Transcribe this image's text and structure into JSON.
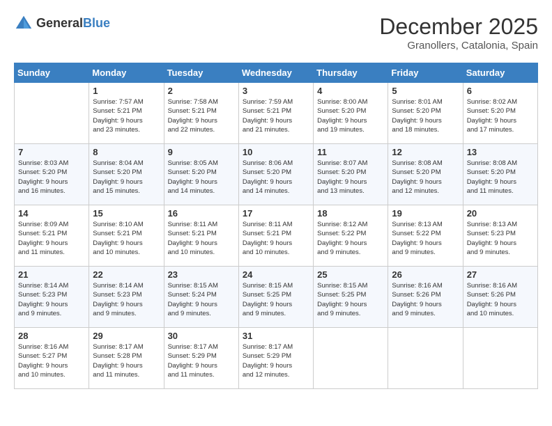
{
  "logo": {
    "general": "General",
    "blue": "Blue"
  },
  "header": {
    "month": "December 2025",
    "location": "Granollers, Catalonia, Spain"
  },
  "days_of_week": [
    "Sunday",
    "Monday",
    "Tuesday",
    "Wednesday",
    "Thursday",
    "Friday",
    "Saturday"
  ],
  "weeks": [
    [
      {
        "day": "",
        "info": ""
      },
      {
        "day": "1",
        "info": "Sunrise: 7:57 AM\nSunset: 5:21 PM\nDaylight: 9 hours\nand 23 minutes."
      },
      {
        "day": "2",
        "info": "Sunrise: 7:58 AM\nSunset: 5:21 PM\nDaylight: 9 hours\nand 22 minutes."
      },
      {
        "day": "3",
        "info": "Sunrise: 7:59 AM\nSunset: 5:21 PM\nDaylight: 9 hours\nand 21 minutes."
      },
      {
        "day": "4",
        "info": "Sunrise: 8:00 AM\nSunset: 5:20 PM\nDaylight: 9 hours\nand 19 minutes."
      },
      {
        "day": "5",
        "info": "Sunrise: 8:01 AM\nSunset: 5:20 PM\nDaylight: 9 hours\nand 18 minutes."
      },
      {
        "day": "6",
        "info": "Sunrise: 8:02 AM\nSunset: 5:20 PM\nDaylight: 9 hours\nand 17 minutes."
      }
    ],
    [
      {
        "day": "7",
        "info": "Sunrise: 8:03 AM\nSunset: 5:20 PM\nDaylight: 9 hours\nand 16 minutes."
      },
      {
        "day": "8",
        "info": "Sunrise: 8:04 AM\nSunset: 5:20 PM\nDaylight: 9 hours\nand 15 minutes."
      },
      {
        "day": "9",
        "info": "Sunrise: 8:05 AM\nSunset: 5:20 PM\nDaylight: 9 hours\nand 14 minutes."
      },
      {
        "day": "10",
        "info": "Sunrise: 8:06 AM\nSunset: 5:20 PM\nDaylight: 9 hours\nand 14 minutes."
      },
      {
        "day": "11",
        "info": "Sunrise: 8:07 AM\nSunset: 5:20 PM\nDaylight: 9 hours\nand 13 minutes."
      },
      {
        "day": "12",
        "info": "Sunrise: 8:08 AM\nSunset: 5:20 PM\nDaylight: 9 hours\nand 12 minutes."
      },
      {
        "day": "13",
        "info": "Sunrise: 8:08 AM\nSunset: 5:20 PM\nDaylight: 9 hours\nand 11 minutes."
      }
    ],
    [
      {
        "day": "14",
        "info": "Sunrise: 8:09 AM\nSunset: 5:21 PM\nDaylight: 9 hours\nand 11 minutes."
      },
      {
        "day": "15",
        "info": "Sunrise: 8:10 AM\nSunset: 5:21 PM\nDaylight: 9 hours\nand 10 minutes."
      },
      {
        "day": "16",
        "info": "Sunrise: 8:11 AM\nSunset: 5:21 PM\nDaylight: 9 hours\nand 10 minutes."
      },
      {
        "day": "17",
        "info": "Sunrise: 8:11 AM\nSunset: 5:21 PM\nDaylight: 9 hours\nand 10 minutes."
      },
      {
        "day": "18",
        "info": "Sunrise: 8:12 AM\nSunset: 5:22 PM\nDaylight: 9 hours\nand 9 minutes."
      },
      {
        "day": "19",
        "info": "Sunrise: 8:13 AM\nSunset: 5:22 PM\nDaylight: 9 hours\nand 9 minutes."
      },
      {
        "day": "20",
        "info": "Sunrise: 8:13 AM\nSunset: 5:23 PM\nDaylight: 9 hours\nand 9 minutes."
      }
    ],
    [
      {
        "day": "21",
        "info": "Sunrise: 8:14 AM\nSunset: 5:23 PM\nDaylight: 9 hours\nand 9 minutes."
      },
      {
        "day": "22",
        "info": "Sunrise: 8:14 AM\nSunset: 5:23 PM\nDaylight: 9 hours\nand 9 minutes."
      },
      {
        "day": "23",
        "info": "Sunrise: 8:15 AM\nSunset: 5:24 PM\nDaylight: 9 hours\nand 9 minutes."
      },
      {
        "day": "24",
        "info": "Sunrise: 8:15 AM\nSunset: 5:25 PM\nDaylight: 9 hours\nand 9 minutes."
      },
      {
        "day": "25",
        "info": "Sunrise: 8:15 AM\nSunset: 5:25 PM\nDaylight: 9 hours\nand 9 minutes."
      },
      {
        "day": "26",
        "info": "Sunrise: 8:16 AM\nSunset: 5:26 PM\nDaylight: 9 hours\nand 9 minutes."
      },
      {
        "day": "27",
        "info": "Sunrise: 8:16 AM\nSunset: 5:26 PM\nDaylight: 9 hours\nand 10 minutes."
      }
    ],
    [
      {
        "day": "28",
        "info": "Sunrise: 8:16 AM\nSunset: 5:27 PM\nDaylight: 9 hours\nand 10 minutes."
      },
      {
        "day": "29",
        "info": "Sunrise: 8:17 AM\nSunset: 5:28 PM\nDaylight: 9 hours\nand 11 minutes."
      },
      {
        "day": "30",
        "info": "Sunrise: 8:17 AM\nSunset: 5:29 PM\nDaylight: 9 hours\nand 11 minutes."
      },
      {
        "day": "31",
        "info": "Sunrise: 8:17 AM\nSunset: 5:29 PM\nDaylight: 9 hours\nand 12 minutes."
      },
      {
        "day": "",
        "info": ""
      },
      {
        "day": "",
        "info": ""
      },
      {
        "day": "",
        "info": ""
      }
    ]
  ]
}
